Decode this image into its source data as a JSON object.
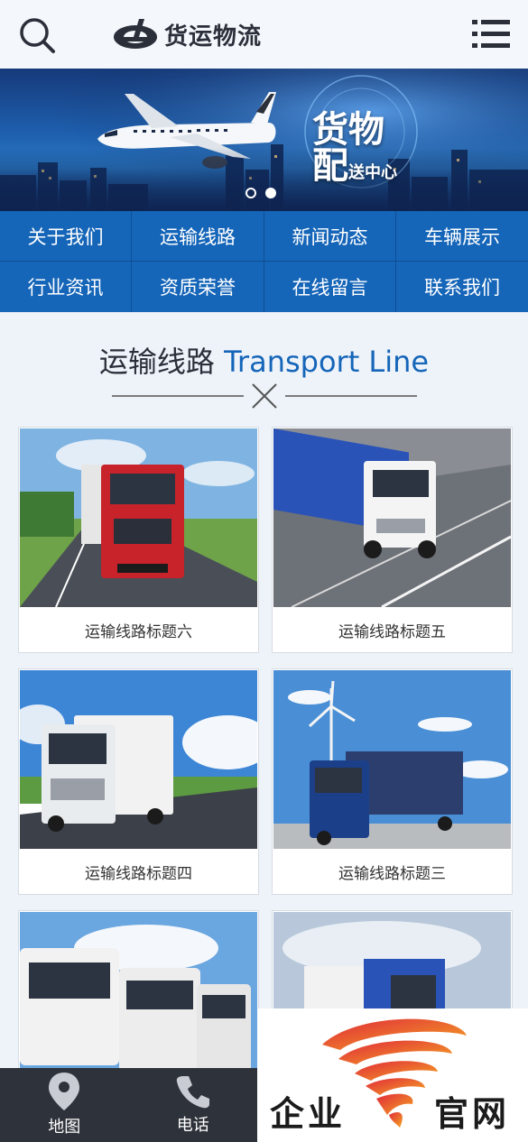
{
  "header": {
    "logo_text": "货运物流",
    "search_icon": "search-icon",
    "menu_icon": "menu-list-icon"
  },
  "banner": {
    "title_line1": "货物",
    "title_line2": "配",
    "title_small": "送中心",
    "slides": 2,
    "active_slide": 1
  },
  "nav": {
    "items": [
      {
        "label": "关于我们"
      },
      {
        "label": "运输线路"
      },
      {
        "label": "新闻动态"
      },
      {
        "label": "车辆展示"
      },
      {
        "label": "行业资讯"
      },
      {
        "label": "资质荣誉"
      },
      {
        "label": "在线留言"
      },
      {
        "label": "联系我们"
      }
    ]
  },
  "section": {
    "title_cn": "运输线路",
    "title_en": "Transport Line"
  },
  "cards": [
    {
      "caption": "运输线路标题六",
      "truck_color": "#c8232b"
    },
    {
      "caption": "运输线路标题五",
      "truck_color": "#2a53b8"
    },
    {
      "caption": "运输线路标题四",
      "truck_color": "#e9ecef"
    },
    {
      "caption": "运输线路标题三",
      "truck_color": "#1c3f8a"
    },
    {
      "caption": "",
      "truck_color": "#f2f2f2"
    },
    {
      "caption": "",
      "truck_color": "#2a53b8"
    }
  ],
  "bottom_bar": {
    "map_label": "地图",
    "phone_label": "电话"
  },
  "watermark": {
    "text_left": "企业",
    "text_right": "官网"
  },
  "colors": {
    "primary": "#1565b8",
    "header_bg": "#f4f7fb",
    "bottom_bar_bg": "#2e323a"
  }
}
